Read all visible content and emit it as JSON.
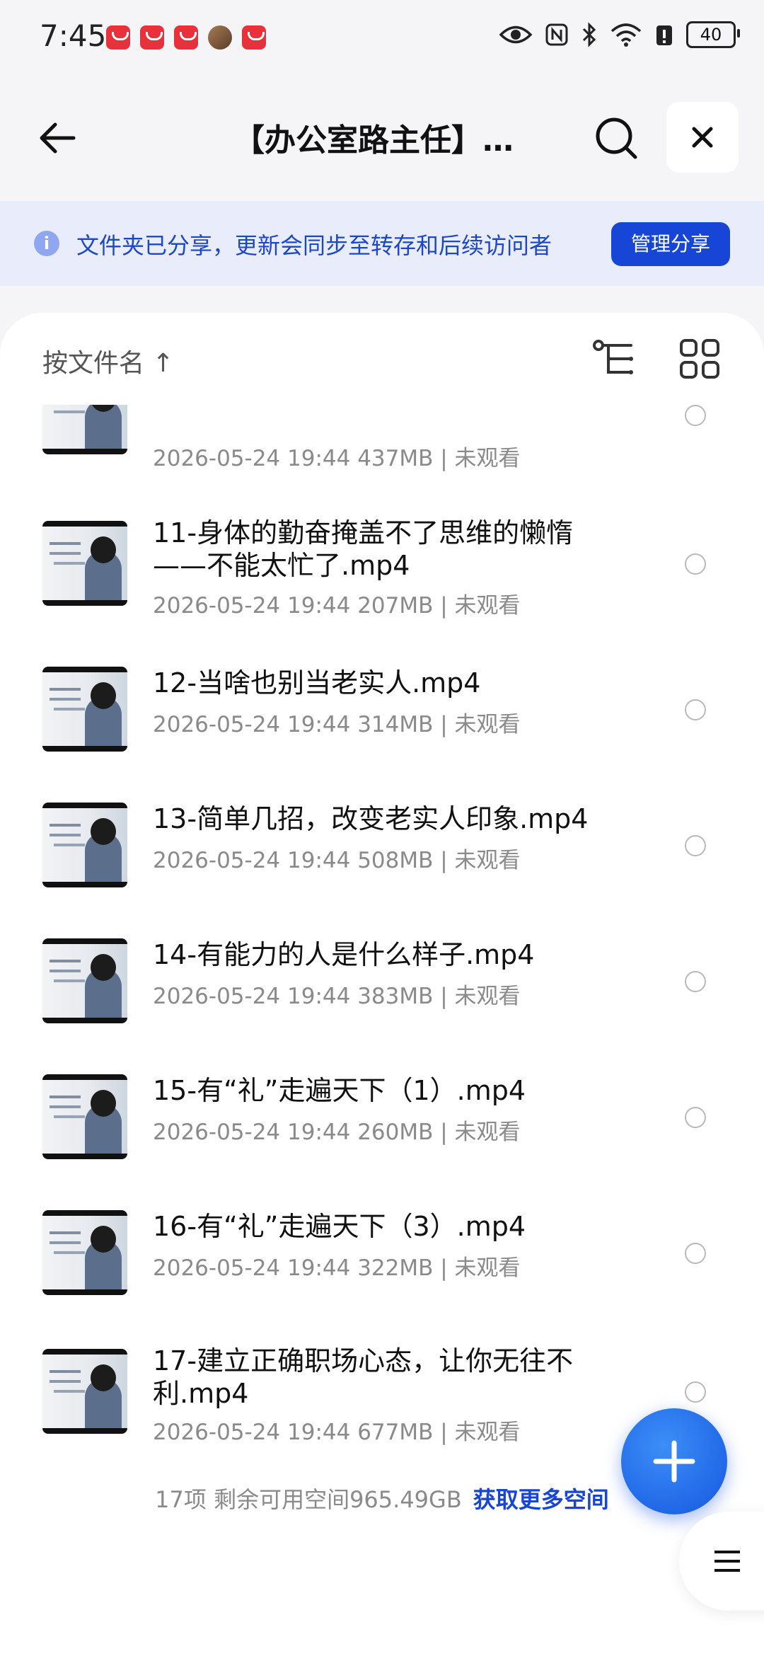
{
  "status_bar": {
    "time": "7:45",
    "battery": "40",
    "notif_icons": [
      "huawei-app-icon",
      "huawei-app-icon",
      "huawei-app-icon",
      "avatar",
      "huawei-app-icon"
    ],
    "sys_icons": [
      "eye-icon",
      "nfc-icon",
      "bluetooth-icon",
      "wifi-icon",
      "battery-saver-icon",
      "battery-icon"
    ]
  },
  "nav": {
    "title": "【办公室路主任】…",
    "back_icon": "arrow-left-icon",
    "search_icon": "search-icon",
    "close_icon": "close-icon"
  },
  "share_banner": {
    "text": "文件夹已分享，更新会同步至转存和后续访问者",
    "button": "管理分享",
    "icon": "info-icon"
  },
  "sort": {
    "label": "按文件名 ↑",
    "icons": [
      "tree-view-icon",
      "grid-view-icon"
    ]
  },
  "files": [
    {
      "name": "",
      "meta": "2026-05-24 19:44  437MB | 未观看"
    },
    {
      "name": "11-身体的勤奋掩盖不了思维的懒惰——不能太忙了.mp4",
      "meta": "2026-05-24 19:44  207MB | 未观看"
    },
    {
      "name": "12-当啥也别当老实人.mp4",
      "meta": "2026-05-24 19:44  314MB | 未观看"
    },
    {
      "name": "13-简单几招，改变老实人印象.mp4",
      "meta": "2026-05-24 19:44  508MB | 未观看"
    },
    {
      "name": "14-有能力的人是什么样子.mp4",
      "meta": "2026-05-24 19:44  383MB | 未观看"
    },
    {
      "name": "15-有“礼”走遍天下（1）.mp4",
      "meta": "2026-05-24 19:44  260MB | 未观看"
    },
    {
      "name": "16-有“礼”走遍天下（3）.mp4",
      "meta": "2026-05-24 19:44  322MB | 未观看"
    },
    {
      "name": "17-建立正确职场心态，让你无往不利.mp4",
      "meta": "2026-05-24 19:44  677MB | 未观看"
    }
  ],
  "footer": {
    "storage": "17项 剩余可用空间965.49GB",
    "link": "获取更多空间"
  },
  "fab": {
    "icon": "plus-icon"
  },
  "menu": {
    "icon": "menu-icon"
  },
  "colors": {
    "accent": "#1745d6",
    "banner_bg": "#e8ecfb"
  }
}
